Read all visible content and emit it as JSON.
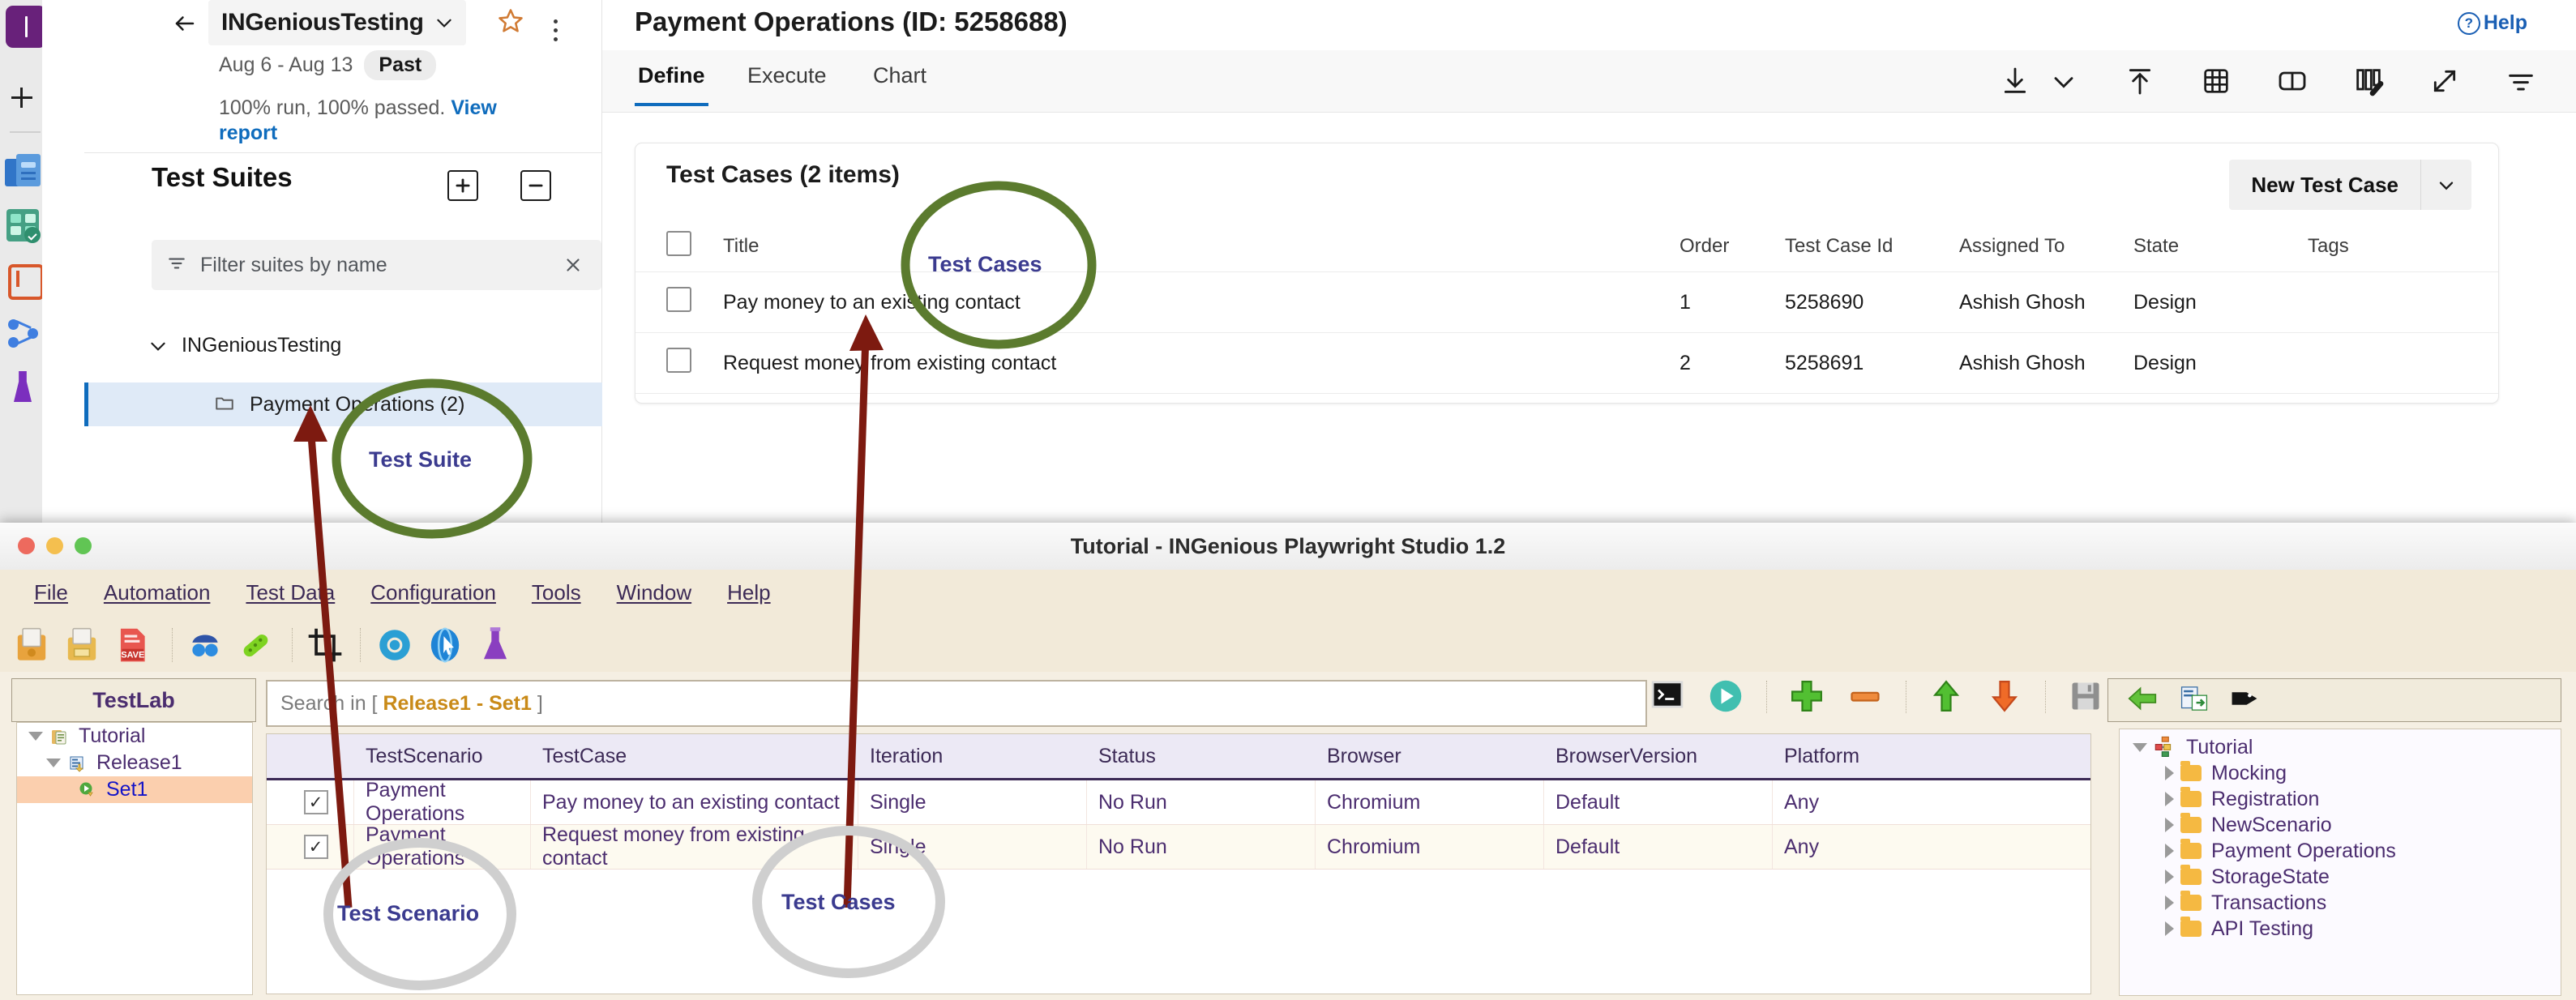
{
  "ado": {
    "project": {
      "name": "INGeniousTesting",
      "date_range": "Aug 6 - Aug 13",
      "status_chip": "Past",
      "run_summary": "100% run, 100% passed.",
      "report_link": "View report",
      "back_icon": "back-arrow-icon",
      "star_icon": "star-icon",
      "more_icon": "more-vertical-icon"
    },
    "rail": {
      "logo_letter": "I",
      "items": [
        {
          "name": "add-icon",
          "label": "+"
        },
        {
          "name": "boards-icon",
          "label": "Boards"
        },
        {
          "name": "test-plans-icon",
          "label": "Test Plans"
        },
        {
          "name": "repos-icon",
          "label": "Repos"
        },
        {
          "name": "pipelines-icon",
          "label": "Pipelines"
        },
        {
          "name": "artifacts-icon",
          "label": "Artifacts"
        }
      ]
    },
    "suites_panel": {
      "title": "Test Suites",
      "add_icon": "add-suite-icon",
      "collapse_icon": "collapse-all-icon",
      "filter_placeholder": "Filter suites by name",
      "clear_icon": "clear-icon",
      "tree": {
        "root": "INGeniousTesting",
        "child": "Payment Operations (2)"
      }
    },
    "main": {
      "title": "Payment Operations (ID: 5258688)",
      "help": "Help",
      "tabs": [
        {
          "label": "Define",
          "active": true
        },
        {
          "label": "Execute",
          "active": false
        },
        {
          "label": "Chart",
          "active": false
        }
      ],
      "toolbar_icons": [
        "download-icon",
        "chevron-down-icon",
        "upload-icon",
        "grid-icon",
        "panel-icon",
        "columns-edit-icon",
        "expand-icon",
        "filter-icon"
      ],
      "card": {
        "heading": "Test Cases (2 items)",
        "new_button": "New Test Case",
        "new_button_arrow": "chevron-down-icon",
        "columns": [
          "Title",
          "Order",
          "Test Case Id",
          "Assigned To",
          "State",
          "Tags"
        ],
        "rows": [
          {
            "title": "Pay money to an existing contact",
            "order": "1",
            "test_case_id": "5258690",
            "assigned_to": "Ashish Ghosh",
            "state": "Design",
            "tags": ""
          },
          {
            "title": "Request money from existing contact",
            "order": "2",
            "test_case_id": "5258691",
            "assigned_to": "Ashish Ghosh",
            "state": "Design",
            "tags": ""
          }
        ]
      }
    }
  },
  "playwright": {
    "window_title": "Tutorial - INGenious Playwright Studio 1.2",
    "traffic_lights": [
      "#ed6a5e",
      "#f4bf4f",
      "#61c554"
    ],
    "menus": [
      "File",
      "Automation",
      "Test Data",
      "Configuration",
      "Tools",
      "Window",
      "Help"
    ],
    "toolbar_icons": [
      "open-project-icon",
      "save-project-icon",
      "save-as-icon",
      "spy-icon",
      "plugin-icon",
      "crop-icon",
      "settings-icon",
      "browser-icon",
      "flask-icon"
    ],
    "testlab": {
      "header": "TestLab",
      "tree": [
        {
          "label": "Tutorial",
          "level": 0,
          "caret": "down",
          "icon": "project-icon",
          "selected": false
        },
        {
          "label": "Release1",
          "level": 1,
          "caret": "down",
          "icon": "release-icon",
          "selected": false
        },
        {
          "label": "Set1",
          "level": 2,
          "caret": "none",
          "icon": "set-icon",
          "selected": true
        }
      ]
    },
    "search": {
      "prefix": "Search in [ ",
      "scope": "Release1 - Set1",
      "suffix": " ]"
    },
    "grid_toolbar_icons": [
      "console-icon",
      "run-icon",
      "add-row-icon",
      "remove-row-icon",
      "move-up-icon",
      "move-down-icon",
      "save-icon",
      "refresh-icon",
      "edit-icon"
    ],
    "grid": {
      "columns": [
        "TestScenario",
        "TestCase",
        "Iteration",
        "Status",
        "Browser",
        "BrowserVersion",
        "Platform"
      ],
      "rows": [
        {
          "checked": true,
          "test_scenario": "Payment Operations",
          "test_case": "Pay money to an existing contact",
          "iteration": "Single",
          "status": "No Run",
          "browser": "Chromium",
          "browser_version": "Default",
          "platform": "Any"
        },
        {
          "checked": true,
          "test_scenario": "Payment Operations",
          "test_case": "Request money from existing contact",
          "iteration": "Single",
          "status": "No Run",
          "browser": "Chromium",
          "browser_version": "Default",
          "platform": "Any"
        }
      ]
    },
    "right_panel": {
      "toolbar_icons": [
        "back-arrow-icon",
        "export-icon",
        "tag-icon"
      ],
      "tree_root": "Tutorial",
      "folders": [
        "Mocking",
        "Registration",
        "NewScenario",
        "Payment Operations",
        "StorageState",
        "Transactions",
        "API Testing"
      ]
    }
  },
  "annotations": {
    "colors": {
      "green_ellipse": "#5b7b2e",
      "gray_ellipse": "#cfcfcf",
      "arrow": "#7d1a10",
      "label_text": "#3b3b8f"
    },
    "labels": [
      {
        "id": "test_cases_top",
        "text": "Test Cases"
      },
      {
        "id": "test_suite",
        "text": "Test Suite"
      },
      {
        "id": "test_scenario",
        "text": "Test Scenario"
      },
      {
        "id": "test_cases_bottom",
        "text": "Test Cases"
      }
    ]
  }
}
